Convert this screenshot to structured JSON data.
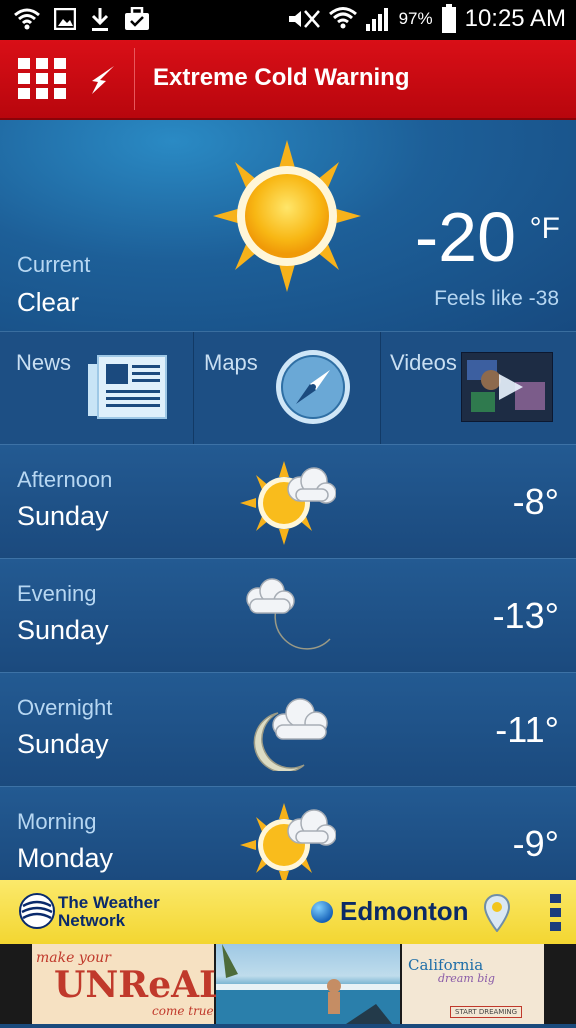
{
  "status_bar": {
    "battery_percent": "97%",
    "time": "10:25 AM",
    "left_icons": [
      "wifi-icon",
      "image-icon",
      "download-icon",
      "briefcase-icon"
    ],
    "right_icons": [
      "mute-icon",
      "wifi-icon",
      "signal-icon",
      "battery-icon"
    ]
  },
  "alert": {
    "text": "Extreme Cold Warning",
    "color": "#d90f17"
  },
  "current": {
    "label": "Current",
    "condition": "Clear",
    "temperature": "-20",
    "unit": "°F",
    "feels_like": "Feels like -38",
    "icon": "sun-icon"
  },
  "media": {
    "items": [
      {
        "label": "News",
        "icon": "newspaper-icon"
      },
      {
        "label": "Maps",
        "icon": "compass-icon"
      },
      {
        "label": "Videos",
        "icon": "video-thumbnail-icon"
      }
    ]
  },
  "forecast": [
    {
      "period": "Afternoon",
      "day": "Sunday",
      "temp": "-8°",
      "icon": "sun-cloud-icon"
    },
    {
      "period": "Evening",
      "day": "Sunday",
      "temp": "-13°",
      "icon": "moon-cloud-icon"
    },
    {
      "period": "Overnight",
      "day": "Sunday",
      "temp": "-11°",
      "icon": "moon-cloud-icon"
    },
    {
      "period": "Morning",
      "day": "Monday",
      "temp": "-9°",
      "icon": "sun-cloud-icon"
    }
  ],
  "bottom_bar": {
    "brand_line1": "The Weather",
    "brand_line2": "Network",
    "city": "Edmonton"
  },
  "ad": {
    "left_line1": "make your",
    "left_line2": "UNReAL",
    "left_line3": "come true",
    "right_line1": "California",
    "right_line2": "dream big",
    "right_button": "START DREAMING"
  }
}
